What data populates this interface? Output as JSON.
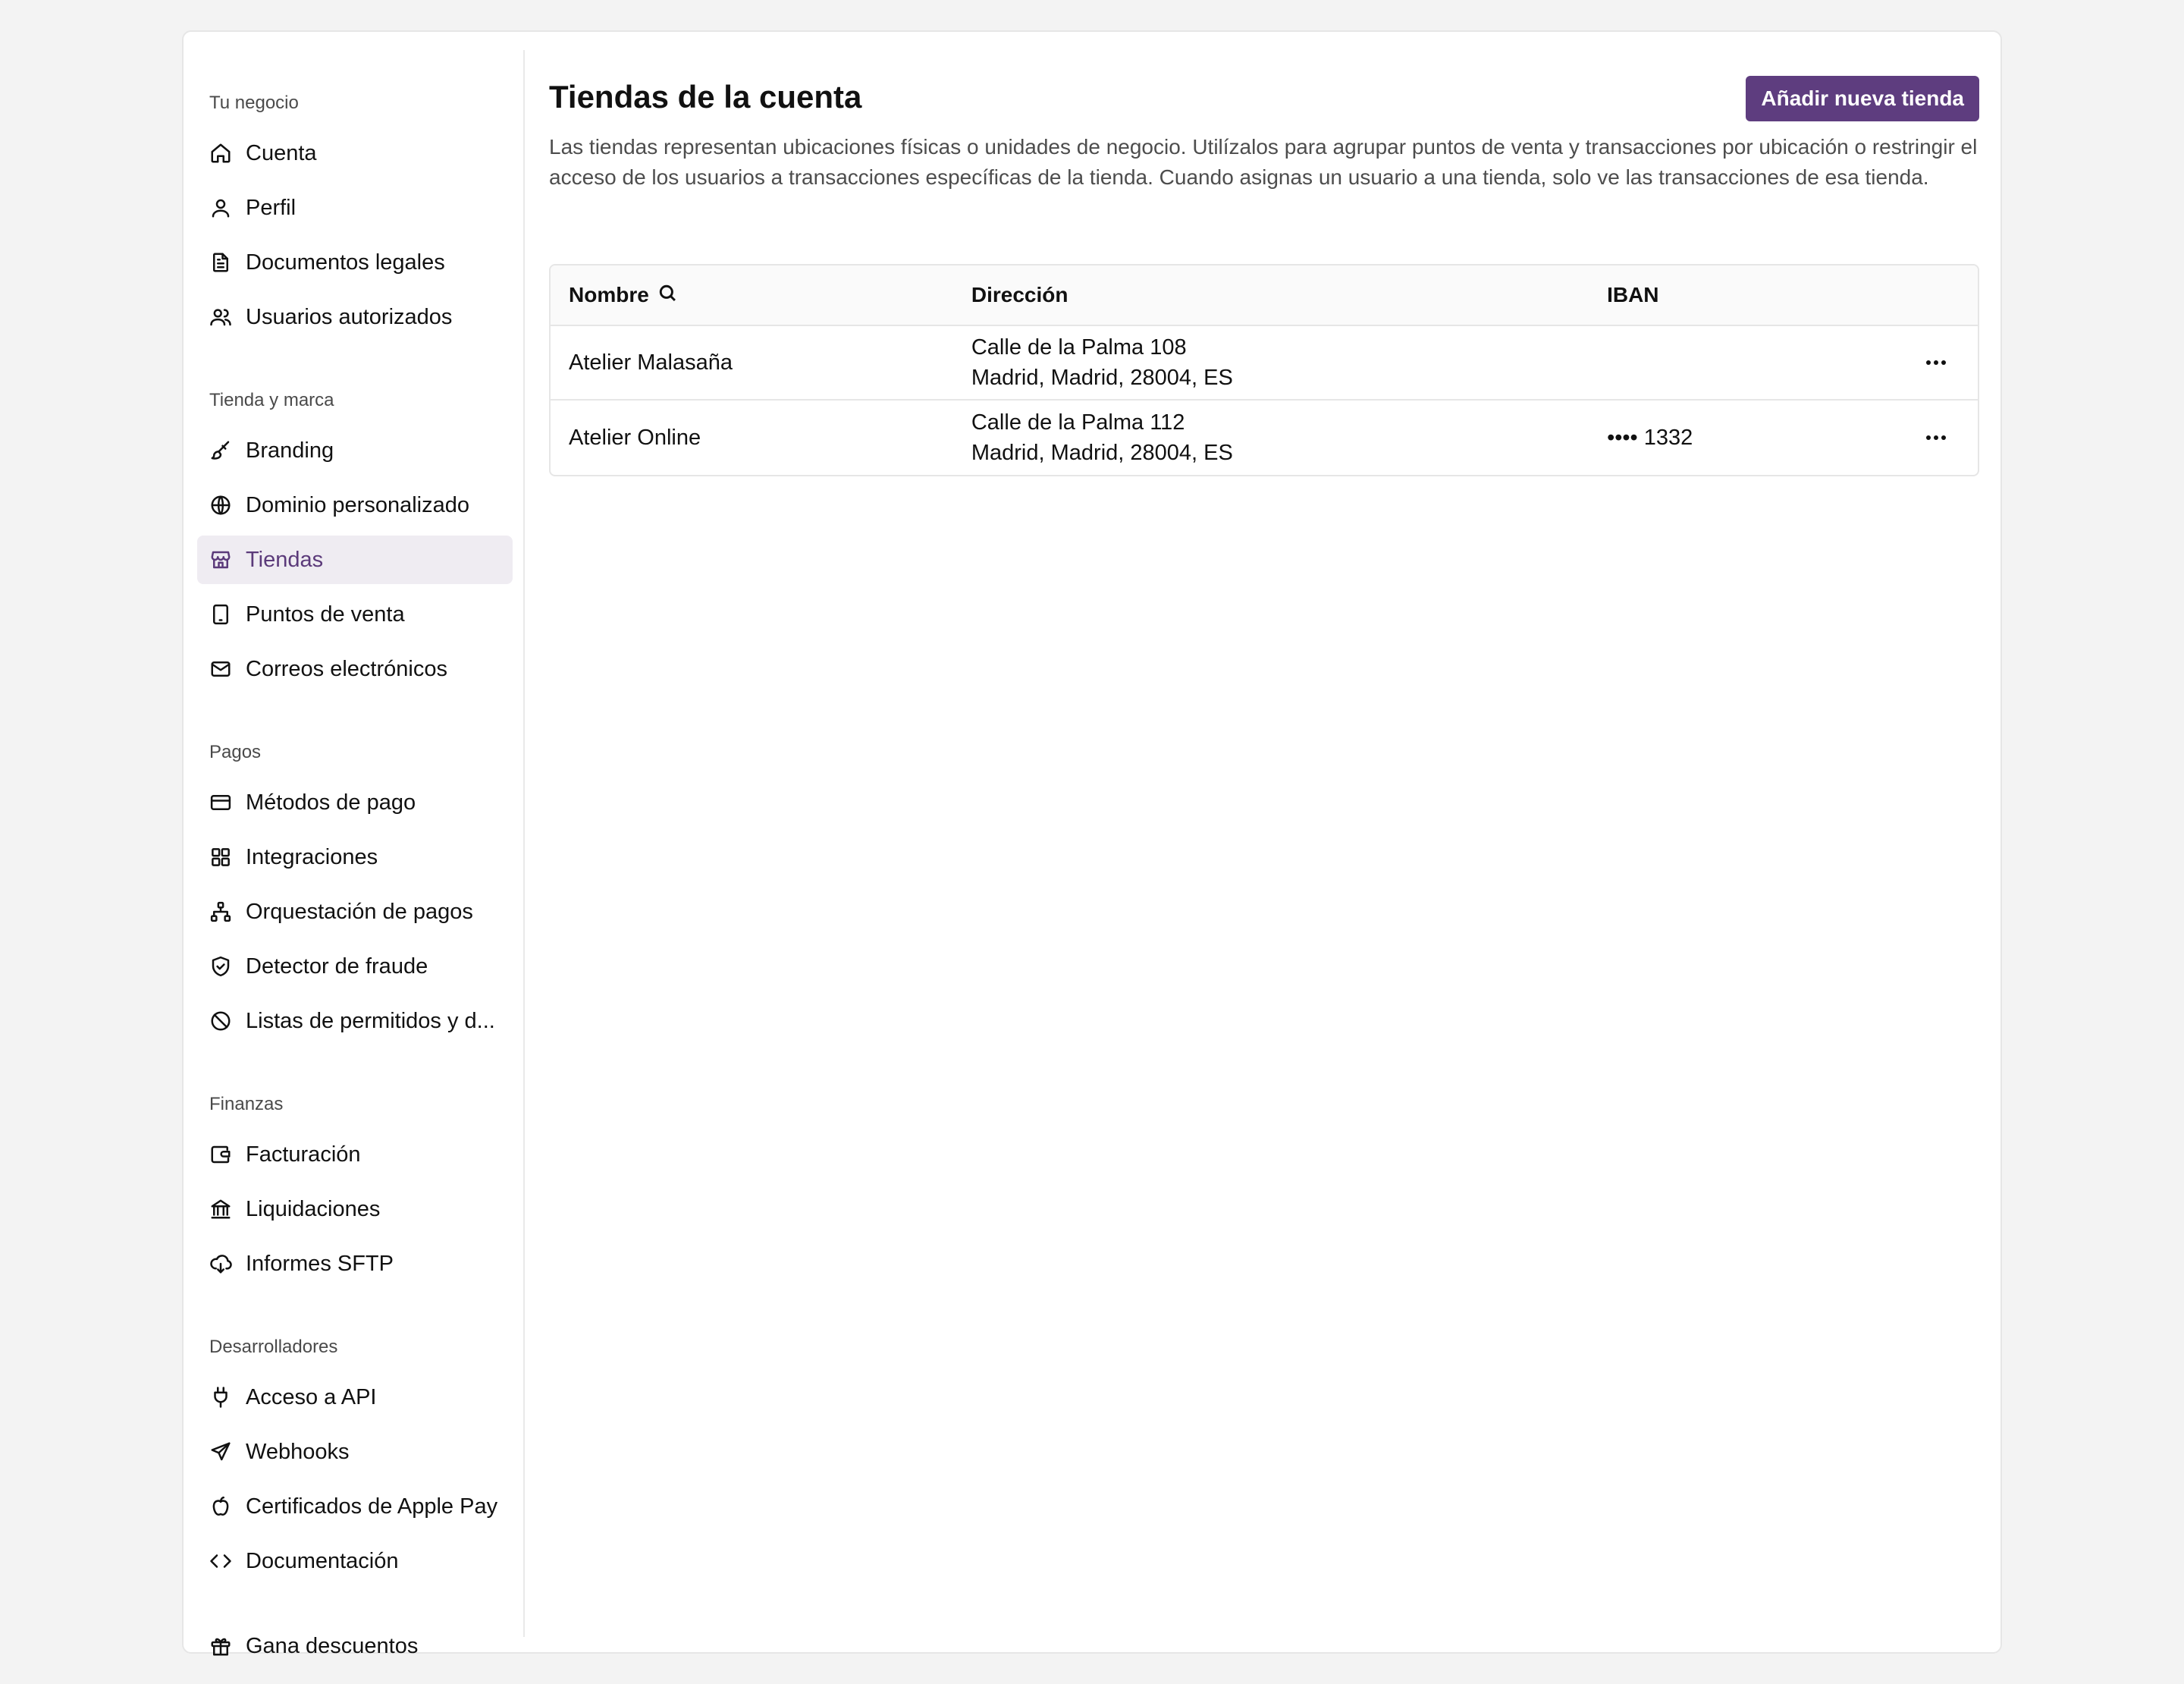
{
  "sidebar": {
    "sections": [
      {
        "label": "Tu negocio",
        "items": [
          {
            "label": "Cuenta",
            "icon": "home-icon"
          },
          {
            "label": "Perfil",
            "icon": "user-icon"
          },
          {
            "label": "Documentos legales",
            "icon": "document-icon"
          },
          {
            "label": "Usuarios autorizados",
            "icon": "users-icon"
          }
        ]
      },
      {
        "label": "Tienda y marca",
        "items": [
          {
            "label": "Branding",
            "icon": "brush-icon"
          },
          {
            "label": "Dominio personalizado",
            "icon": "globe-icon"
          },
          {
            "label": "Tiendas",
            "icon": "store-icon",
            "active": true
          },
          {
            "label": "Puntos de venta",
            "icon": "tablet-icon"
          },
          {
            "label": "Correos electrónicos",
            "icon": "mail-icon"
          }
        ]
      },
      {
        "label": "Pagos",
        "items": [
          {
            "label": "Métodos de pago",
            "icon": "credit-card-icon"
          },
          {
            "label": "Integraciones",
            "icon": "grid-icon"
          },
          {
            "label": "Orquestación de pagos",
            "icon": "network-icon"
          },
          {
            "label": "Detector de fraude",
            "icon": "shield-check-icon"
          },
          {
            "label": "Listas de permitidos y d...",
            "icon": "ban-icon"
          }
        ]
      },
      {
        "label": "Finanzas",
        "items": [
          {
            "label": "Facturación",
            "icon": "wallet-icon"
          },
          {
            "label": "Liquidaciones",
            "icon": "bank-icon"
          },
          {
            "label": "Informes SFTP",
            "icon": "cloud-download-icon"
          }
        ]
      },
      {
        "label": "Desarrolladores",
        "items": [
          {
            "label": "Acceso a API",
            "icon": "plug-icon"
          },
          {
            "label": "Webhooks",
            "icon": "send-icon"
          },
          {
            "label": "Certificados de Apple Pay",
            "icon": "apple-icon"
          },
          {
            "label": "Documentación",
            "icon": "code-icon"
          }
        ]
      }
    ],
    "footer_item": {
      "label": "Gana descuentos",
      "icon": "gift-icon"
    }
  },
  "main": {
    "title": "Tiendas de la cuenta",
    "add_button": "Añadir nueva tienda",
    "description": "Las tiendas representan ubicaciones físicas o unidades de negocio. Utilízalos para agrupar puntos de venta y transacciones por ubicación o restringir el acceso de los usuarios a transacciones específicas de la tienda. Cuando asignas un usuario a una tienda, solo ve las transacciones de esa tienda.",
    "table": {
      "headers": {
        "name": "Nombre",
        "address": "Dirección",
        "iban": "IBAN"
      },
      "rows": [
        {
          "name": "Atelier Malasaña",
          "address_line1": "Calle de la Palma 108",
          "address_line2": "Madrid, Madrid, 28004, ES",
          "iban": ""
        },
        {
          "name": "Atelier Online",
          "address_line1": "Calle de la Palma 112",
          "address_line2": "Madrid, Madrid, 28004, ES",
          "iban": "•••• 1332"
        }
      ]
    }
  },
  "colors": {
    "accent": "#5e3d7f",
    "active_bg": "#efecf2",
    "active_text": "#5b3a7a"
  }
}
